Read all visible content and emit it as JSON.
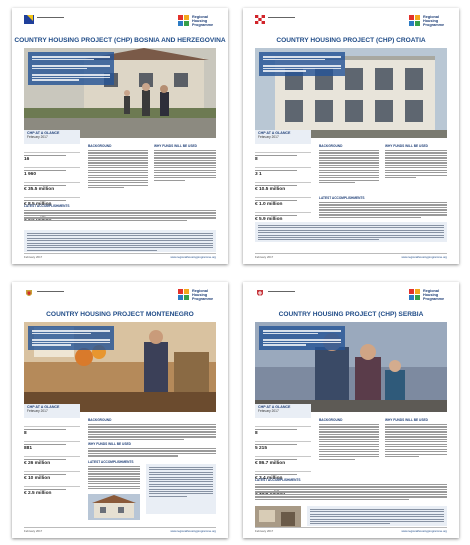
{
  "documents": [
    {
      "title": "COUNTRY HOUSING PROJECT (CHP) BOSNIA AND HERZEGOVINA",
      "glance_title": "CHP AT A GLANCE",
      "glance_date": "February 2017",
      "stats": [
        "16",
        "1 960",
        "€ 35.5 million",
        "€ 8.5 million",
        "€ 6.9 million*"
      ],
      "col1_heading": "BACKGROUND",
      "col2_heading": "WHY FUNDS WILL BE USED",
      "latest_heading": "LATEST ACCOMPLISHMENTS",
      "footer_date": "February 2017",
      "footer_url": "www.regionalhousingprogramme.org",
      "logo_text": [
        "Regional",
        "Housing",
        "Programme"
      ]
    },
    {
      "title": "COUNTRY HOUSING PROJECT (CHP) CROATIA",
      "glance_title": "CHP AT A GLANCE",
      "glance_date": "February 2017",
      "stats": [
        "8",
        "3 1",
        "€ 10.5 million",
        "€ 1.0 million",
        "€ 5.9 million"
      ],
      "col1_heading": "BACKGROUND",
      "col2_heading": "WHY FUNDS WILL BE USED",
      "latest_heading": "LATEST ACCOMPLISHMENTS",
      "footer_date": "February 2017",
      "footer_url": "www.regionalhousingprogramme.org",
      "logo_text": [
        "Regional",
        "Housing",
        "Programme"
      ]
    },
    {
      "title": "COUNTRY HOUSING PROJECT MONTENEGRO",
      "glance_title": "CHP AT A GLANCE",
      "glance_date": "February 2017",
      "stats": [
        "8",
        "881",
        "€ 26 million",
        "€ 10 million",
        "€ 2.5 million"
      ],
      "col1_heading": "BACKGROUND",
      "col2_heading": "WHY FUNDS WILL BE USED",
      "latest_heading": "LATEST ACCOMPLISHMENTS",
      "footer_date": "February 2017",
      "footer_url": "www.regionalhousingprogramme.org",
      "logo_text": [
        "Regional",
        "Housing",
        "Programme"
      ]
    },
    {
      "title": "COUNTRY HOUSING PROJECT (CHP) SERBIA",
      "glance_title": "CHP AT A GLANCE",
      "glance_date": "February 2017",
      "stats": [
        "8",
        "5 215",
        "€ 86.7 million",
        "€ 3.4 million",
        "€ 16.8 million*"
      ],
      "col1_heading": "BACKGROUND",
      "col2_heading": "WHY FUNDS WILL BE USED",
      "latest_heading": "LATEST ACCOMPLISHMENTS",
      "footer_date": "February 2017",
      "footer_url": "www.regionalhousingprogramme.org",
      "logo_text": [
        "Regional",
        "Housing",
        "Programme"
      ]
    }
  ],
  "colors": {
    "title_blue": "#1f4b87",
    "overlay_blue": "#265496",
    "glance_bg": "#e9eef5"
  }
}
